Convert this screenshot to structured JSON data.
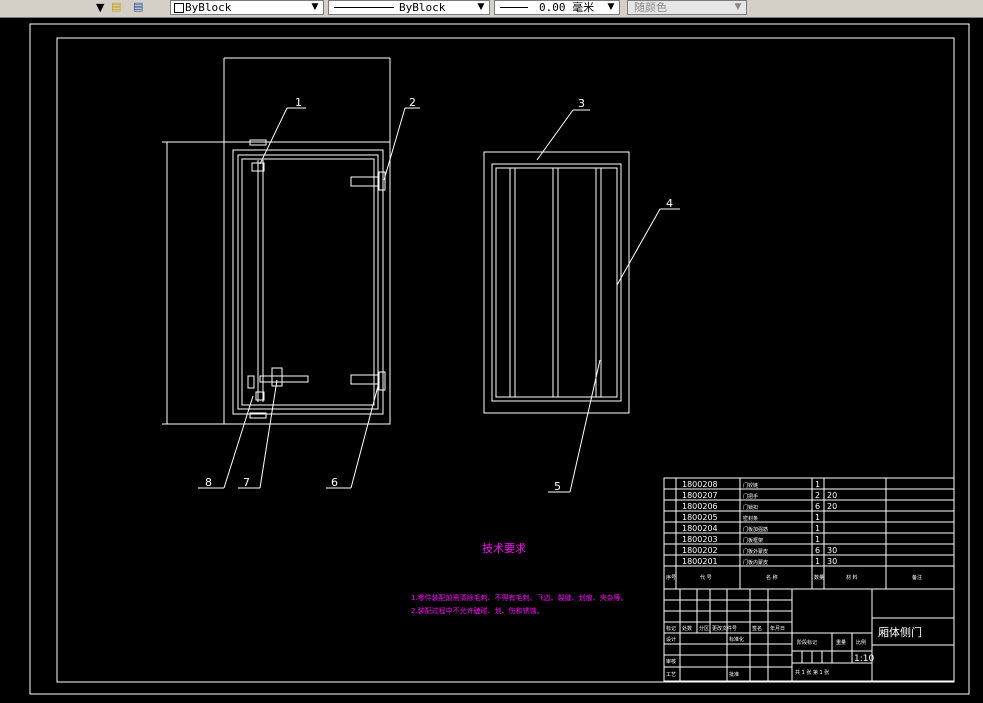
{
  "toolbar": {
    "linetype_combo": "ByBlock",
    "lineweight_combo": "ByBlock",
    "plotwidth_combo": "0.00 毫米",
    "color_combo": "随颜色"
  },
  "drawing": {
    "callouts": [
      "1",
      "2",
      "3",
      "4",
      "5",
      "6",
      "7",
      "8"
    ],
    "tech_title": "技术要求",
    "tech_notes": [
      "1.零件装配前需清除毛刺、不得有毛刺、飞边、裂缝、划痕、夹杂等。",
      "2.装配过程中不允许磕碰、划、伤和锈蚀。"
    ],
    "parts": [
      {
        "code": "1800208",
        "name": "门铰链",
        "qty": "1",
        "mat": ""
      },
      {
        "code": "1800207",
        "name": "门把手",
        "qty": "2",
        "mat": "20"
      },
      {
        "code": "1800206",
        "name": "门锁扣",
        "qty": "6",
        "mat": "20"
      },
      {
        "code": "1800205",
        "name": "密封条",
        "qty": "1",
        "mat": ""
      },
      {
        "code": "1800204",
        "name": "门板加强筋",
        "qty": "1",
        "mat": ""
      },
      {
        "code": "1800203",
        "name": "门板框架",
        "qty": "1",
        "mat": ""
      },
      {
        "code": "1800202",
        "name": "门板外蒙皮",
        "qty": "6",
        "mat": "30"
      },
      {
        "code": "1800201",
        "name": "门板内蒙皮",
        "qty": "1",
        "mat": "30"
      }
    ],
    "header_row": {
      "seq": "序号",
      "code": "代 号",
      "name": "名 称",
      "qty": "数量",
      "mat": "材 料",
      "note": "备注"
    },
    "title_name": "厢体侧门",
    "scale": "1:10",
    "sheet": "共 1 张  第 1 张",
    "labels": {
      "mark": "标记",
      "count": "处数",
      "zone": "分区",
      "docno": "更改文件号",
      "sign": "签名",
      "date": "年月日",
      "design": "设计",
      "std": "标准化",
      "stage": "阶段标记",
      "weight": "重量",
      "scale_label": "比例",
      "check": "审核",
      "process": "工艺",
      "approve": "批准"
    }
  },
  "colors": {
    "white": "#ffffff",
    "cyan": "#00ffff",
    "magenta": "#ff00ff"
  }
}
